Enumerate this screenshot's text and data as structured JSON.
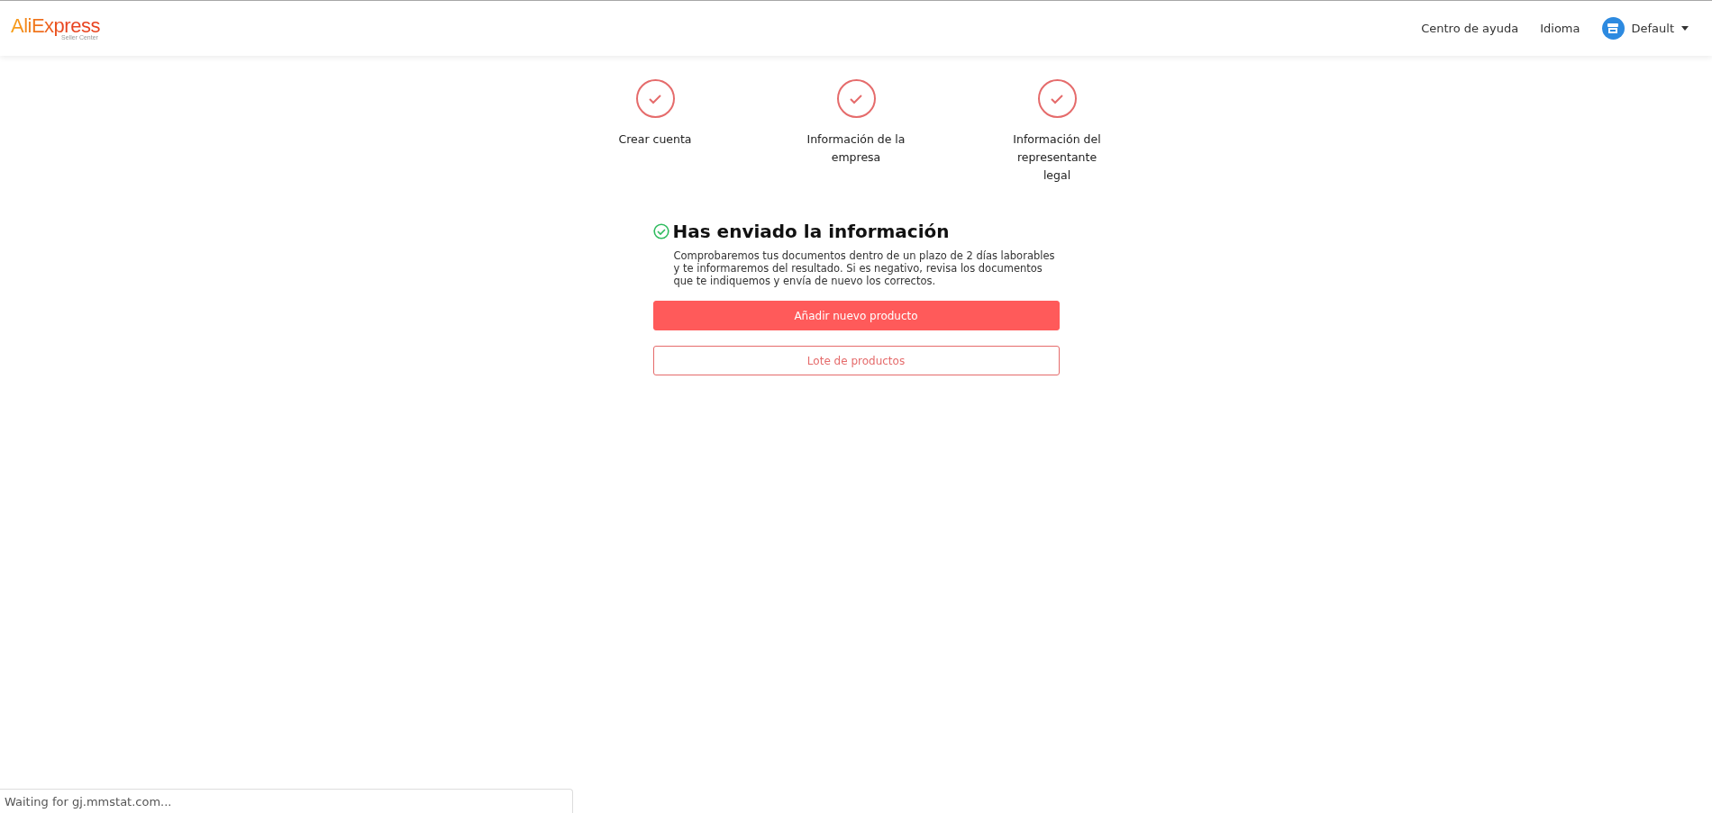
{
  "header": {
    "logo": {
      "brand": "AliExpress",
      "subtitle": "Seller Center"
    },
    "links": [
      "Centro de ayuda",
      "Idioma"
    ],
    "account": {
      "name": "Default"
    }
  },
  "steps": [
    {
      "label": "Crear cuenta",
      "completed": true
    },
    {
      "label": "Información de la empresa",
      "completed": true
    },
    {
      "label": "Información del representante legal",
      "completed": true
    }
  ],
  "result": {
    "title": "Has enviado la información",
    "message": "Comprobaremos tus documentos dentro de un plazo de 2 días laborables y te informaremos del resultado. Si es negativo, revisa los documentos que te indiquemos y envía de nuevo los correctos.",
    "buttons": [
      {
        "label": "Añadir nuevo producto",
        "kind": "primary"
      },
      {
        "label": "Lote de productos",
        "kind": "outline"
      }
    ]
  },
  "status_bar": "Waiting for gj.mmstat.com..."
}
